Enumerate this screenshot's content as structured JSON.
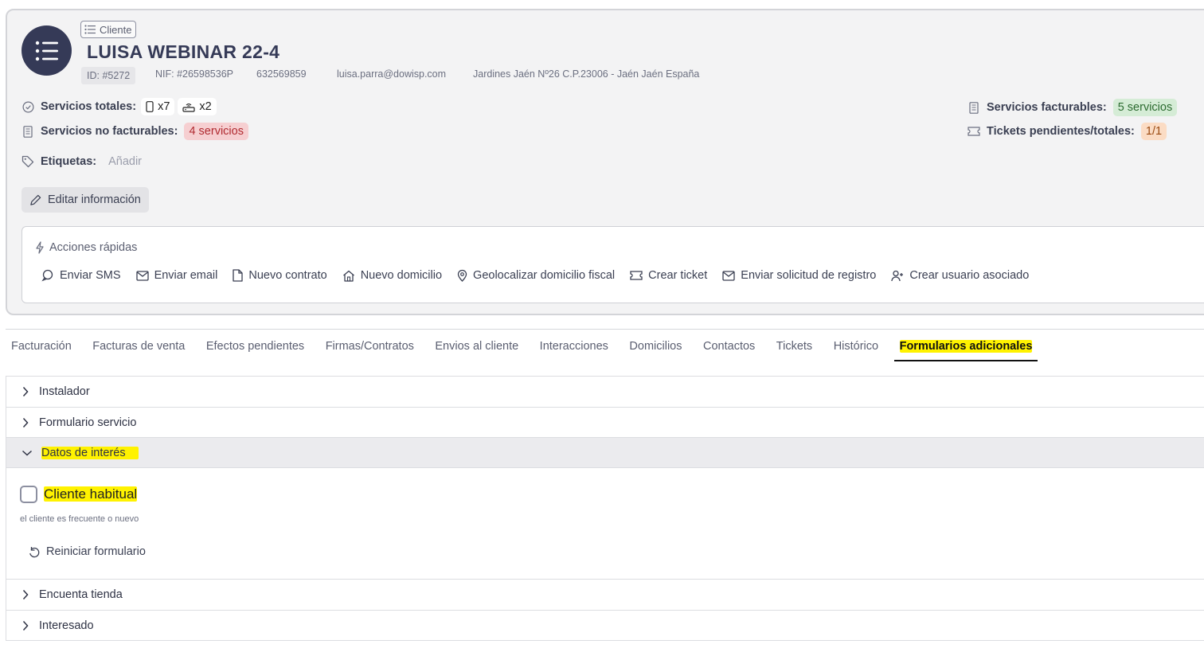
{
  "client": {
    "badge": "Cliente",
    "name": "LUISA WEBINAR 22-4",
    "id": "ID: #5272",
    "nif": "NIF: #26598536P",
    "phone": "632569859",
    "email": "luisa.parra@dowisp.com",
    "address": "Jardines Jaén Nº26 C.P.23006 - Jaén Jaén España"
  },
  "stats": {
    "total_label": "Servicios totales:",
    "total_mobile": "x7",
    "total_router": "x2",
    "non_billable_label": "Servicios no facturables:",
    "non_billable_value": "4 servicios",
    "billable_label": "Servicios facturables:",
    "billable_value": "5 servicios",
    "tickets_label": "Tickets pendientes/totales:",
    "tickets_value": "1/1",
    "tags_label": "Etiquetas:",
    "tags_add": "Añadir"
  },
  "edit_button": "Editar información",
  "quick_actions": {
    "title": "Acciones rápidas",
    "items": [
      "Enviar SMS",
      "Enviar email",
      "Nuevo contrato",
      "Nuevo domicilio",
      "Geolocalizar domicilio fiscal",
      "Crear ticket",
      "Enviar solicitud de registro",
      "Crear usuario asociado"
    ]
  },
  "tabs": [
    "Facturación",
    "Facturas de venta",
    "Efectos pendientes",
    "Firmas/Contratos",
    "Envios al cliente",
    "Interacciones",
    "Domicilios",
    "Contactos",
    "Tickets",
    "Histórico",
    "Formularios adicionales"
  ],
  "active_tab": "Formularios adicionales",
  "accordion": {
    "sections": [
      "Instalador",
      "Formulario servicio",
      "Datos de interés",
      "Encuenta tienda",
      "Interesado"
    ],
    "open_section": "Datos de interés",
    "checkbox_label": "Cliente habitual",
    "checkbox_checked": false,
    "checkbox_help": "el cliente es frecuente o nuevo",
    "reset_label": "Reiniciar formulario"
  },
  "colors": {
    "primary": "#353a57",
    "highlight": "#fff200",
    "chip_red_bg": "#f6cfd1",
    "chip_green_bg": "#d5ecd6",
    "chip_orange_bg": "#fbdcc4"
  }
}
